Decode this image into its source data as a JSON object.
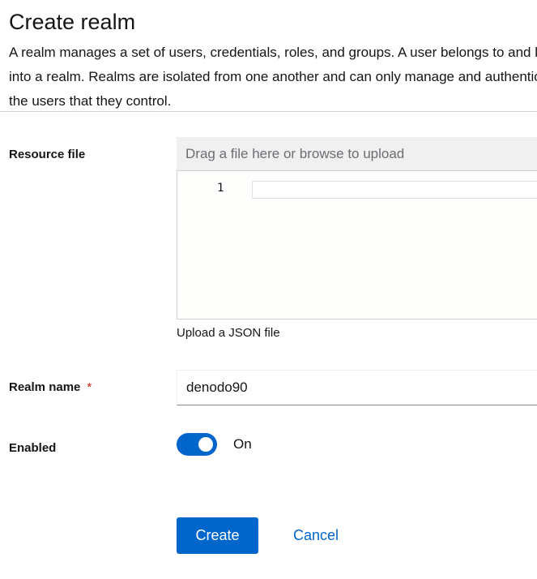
{
  "header": {
    "title": "Create realm",
    "description": "A realm manages a set of users, credentials, roles, and groups. A user belongs to and logs into a realm. Realms are isolated from one another and can only manage and authenticate the users that they control."
  },
  "form": {
    "resource_file": {
      "label": "Resource file",
      "drop_placeholder": "Drag a file here or browse to upload",
      "editor_line_number": "1",
      "helper_text": "Upload a JSON file"
    },
    "realm_name": {
      "label": "Realm name",
      "required_mark": "*",
      "value": "denodo90"
    },
    "enabled": {
      "label": "Enabled",
      "state_label": "On",
      "checked": true
    },
    "actions": {
      "create_label": "Create",
      "cancel_label": "Cancel"
    }
  },
  "colors": {
    "primary": "#0066cc",
    "required": "#c9190b",
    "divider": "#d2d2d2"
  }
}
